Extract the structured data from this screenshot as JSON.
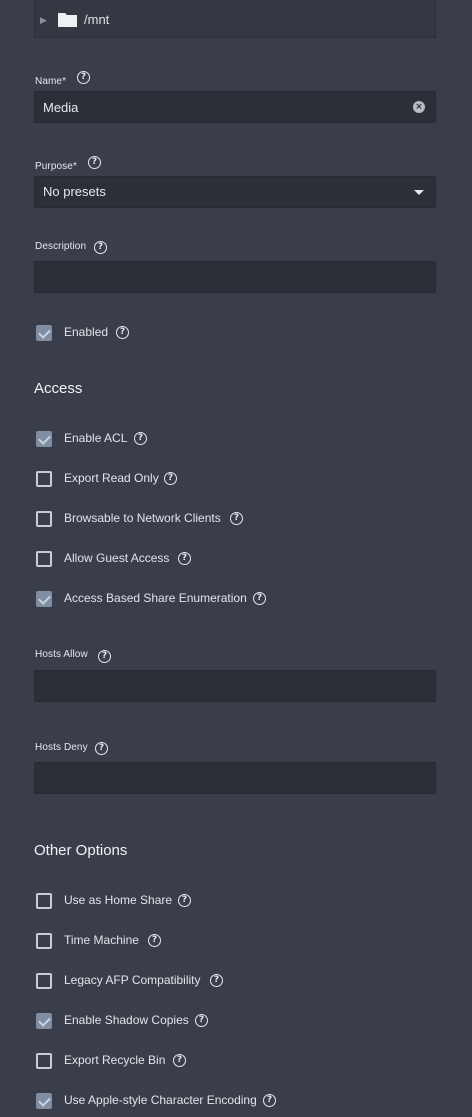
{
  "tree": {
    "path": "/mnt",
    "expand_icon": "triangle-right-icon",
    "folder_icon": "folder-icon"
  },
  "name_field": {
    "label": "Name",
    "required": "*",
    "value": "Media",
    "clear_icon": "clear-icon",
    "help": "?"
  },
  "purpose_field": {
    "label": "Purpose",
    "required": "*",
    "value": "No presets",
    "help": "?"
  },
  "description_field": {
    "label": "Description",
    "value": "",
    "help": "?"
  },
  "enabled": {
    "label": "Enabled",
    "checked": true,
    "help": "?"
  },
  "access": {
    "title": "Access",
    "options": [
      {
        "label": "Enable ACL",
        "checked": true
      },
      {
        "label": "Export Read Only",
        "checked": false
      },
      {
        "label": "Browsable to Network Clients",
        "checked": false
      },
      {
        "label": "Allow Guest Access",
        "checked": false
      },
      {
        "label": "Access Based Share Enumeration",
        "checked": true
      }
    ]
  },
  "hosts_allow": {
    "label": "Hosts Allow",
    "value": "",
    "help": "?"
  },
  "hosts_deny": {
    "label": "Hosts Deny",
    "value": "",
    "help": "?"
  },
  "other": {
    "title": "Other Options",
    "options": [
      {
        "label": "Use as Home Share",
        "checked": false
      },
      {
        "label": "Time Machine",
        "checked": false
      },
      {
        "label": "Legacy AFP Compatibility",
        "checked": false
      },
      {
        "label": "Enable Shadow Copies",
        "checked": true
      },
      {
        "label": "Export Recycle Bin",
        "checked": false
      },
      {
        "label": "Use Apple-style Character Encoding",
        "checked": true
      }
    ]
  },
  "help_glyph": "?"
}
